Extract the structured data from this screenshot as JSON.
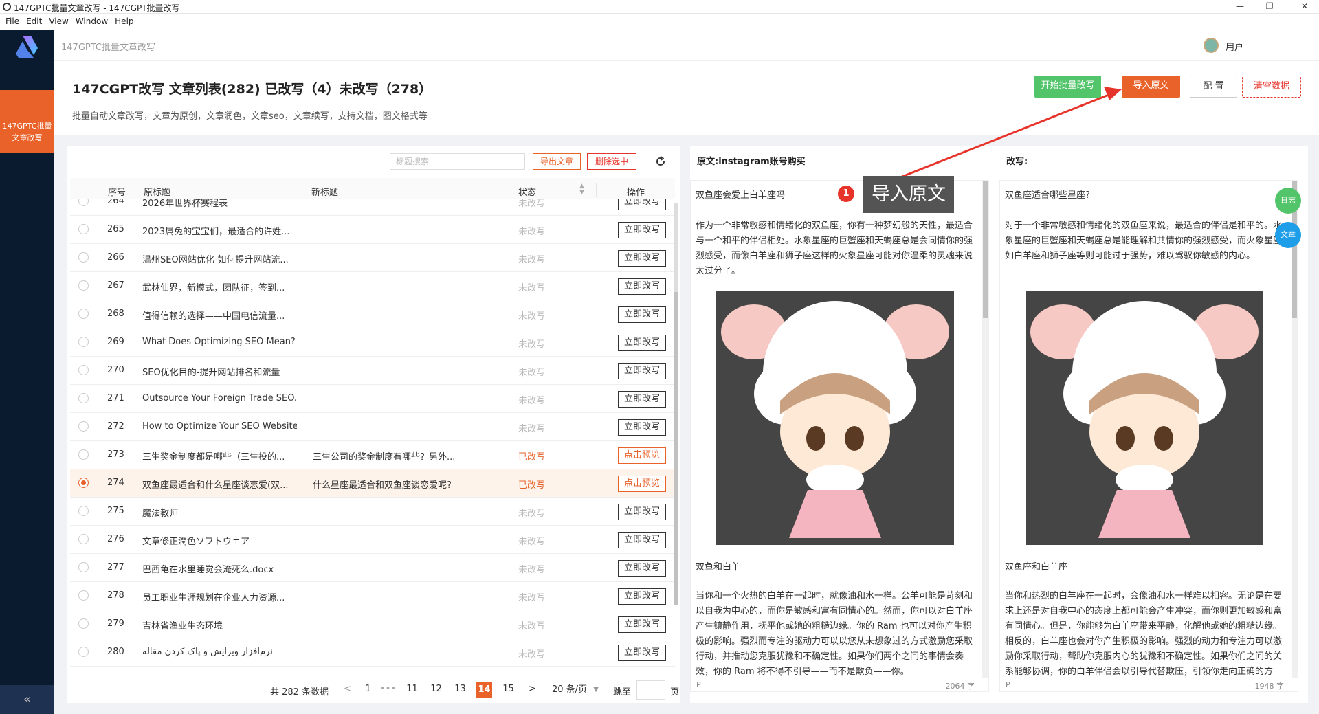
{
  "window": {
    "title": "147GPTC批量文章改写 - 147CGPT批量改写"
  },
  "menu": [
    "File",
    "Edit",
    "View",
    "Window",
    "Help"
  ],
  "sidebar": {
    "nav_line1": "147GPTC批量",
    "nav_line2": "文章改写",
    "collapse": "«"
  },
  "header": {
    "app_name": "147GPTC批量文章改写",
    "user": "用户"
  },
  "page": {
    "title": "147CGPT改写 文章列表(282) 已改写（4）未改写（278）",
    "description": "批量自动文章改写，文章为原创，文章润色，文章seo，文章续写，支持文档，图文格式等",
    "buttons": {
      "start": "开始批量改写",
      "import": "导入原文",
      "config": "配 置",
      "clear": "清空数据"
    }
  },
  "list": {
    "search_placeholder": "标题搜索",
    "export": "导出文章",
    "delete_selected": "删除选中",
    "columns": {
      "no": "序号",
      "orig": "原标题",
      "new": "新标题",
      "status": "状态",
      "action": "操作"
    },
    "rows": [
      {
        "no": "264",
        "orig": "2026年世界杯赛程表",
        "new": "",
        "status": "未改写",
        "action": "立即改写",
        "done": false,
        "selected": false
      },
      {
        "no": "265",
        "orig": "2023属兔的宝宝们，最适合的许姓...",
        "new": "",
        "status": "未改写",
        "action": "立即改写",
        "done": false,
        "selected": false
      },
      {
        "no": "266",
        "orig": "温州SEO网站优化-如何提升网站流...",
        "new": "",
        "status": "未改写",
        "action": "立即改写",
        "done": false,
        "selected": false
      },
      {
        "no": "267",
        "orig": "武林仙界，新模式，团队征，签到...",
        "new": "",
        "status": "未改写",
        "action": "立即改写",
        "done": false,
        "selected": false
      },
      {
        "no": "268",
        "orig": "值得信赖的选择——中国电信流量...",
        "new": "",
        "status": "未改写",
        "action": "立即改写",
        "done": false,
        "selected": false
      },
      {
        "no": "269",
        "orig": "What Does Optimizing SEO Mean?",
        "new": "",
        "status": "未改写",
        "action": "立即改写",
        "done": false,
        "selected": false
      },
      {
        "no": "270",
        "orig": "SEO优化目的-提升网站排名和流量",
        "new": "",
        "status": "未改写",
        "action": "立即改写",
        "done": false,
        "selected": false
      },
      {
        "no": "271",
        "orig": "Outsource Your Foreign Trade SEO...",
        "new": "",
        "status": "未改写",
        "action": "立即改写",
        "done": false,
        "selected": false
      },
      {
        "no": "272",
        "orig": "How to Optimize Your SEO Website",
        "new": "",
        "status": "未改写",
        "action": "立即改写",
        "done": false,
        "selected": false
      },
      {
        "no": "273",
        "orig": "三生奖金制度都是哪些（三生投的...",
        "new": "三生公司的奖金制度有哪些？另外...",
        "status": "已改写",
        "action": "点击预览",
        "done": true,
        "selected": false
      },
      {
        "no": "274",
        "orig": "双鱼座最适合和什么星座谈恋爱(双...",
        "new": "什么星座最适合和双鱼座谈恋爱呢?",
        "status": "已改写",
        "action": "点击预览",
        "done": true,
        "selected": true
      },
      {
        "no": "275",
        "orig": "魔法教师",
        "new": "",
        "status": "未改写",
        "action": "立即改写",
        "done": false,
        "selected": false
      },
      {
        "no": "276",
        "orig": "文章修正潤色ソフトウェア",
        "new": "",
        "status": "未改写",
        "action": "立即改写",
        "done": false,
        "selected": false
      },
      {
        "no": "277",
        "orig": "巴西龟在水里睡觉会淹死么.docx",
        "new": "",
        "status": "未改写",
        "action": "立即改写",
        "done": false,
        "selected": false
      },
      {
        "no": "278",
        "orig": "员工职业生涯规划在企业人力资源...",
        "new": "",
        "status": "未改写",
        "action": "立即改写",
        "done": false,
        "selected": false
      },
      {
        "no": "279",
        "orig": "吉林省渔业生态环境",
        "new": "",
        "status": "未改写",
        "action": "立即改写",
        "done": false,
        "selected": false
      },
      {
        "no": "280",
        "orig": "نرم‌افزار ویرایش و پاک کردن مقاله",
        "new": "",
        "status": "未改写",
        "action": "立即改写",
        "done": false,
        "selected": false
      }
    ],
    "pager": {
      "total": "共 282 条数据",
      "prev": "<",
      "next": ">",
      "ellipsis": "•••",
      "pages": [
        "1",
        "11",
        "12",
        "13",
        "14",
        "15"
      ],
      "current": "14",
      "page_size": "20 条/页",
      "jump": "跳至",
      "page_unit": "页"
    }
  },
  "original": {
    "header": "原文:instagram账号购买",
    "title": "双鱼座会爱上白羊座吗",
    "para1": "作为一个非常敏感和情绪化的双鱼座，你有一种梦幻般的天性，最适合与一个和平的伴侣相处。水象星座的巨蟹座和天蝎座总是会同情你的强烈感受，而像白羊座和狮子座这样的火象星座可能对你温柔的灵魂来说太过分了。",
    "subtitle": "双鱼和白羊",
    "para2": "当你和一个火热的白羊在一起时，就像油和水一样。公羊可能是苛刻和以自我为中心的，而你是敏感和富有同情心的。然而，你可以对白羊座产生镇静作用，抚平他或她的粗糙边缘。你的 Ram 也可以对你产生积极的影响。强烈而专注的驱动力可以以您从未想象过的方式激励您采取行动，并推动您克服犹豫和不确定性。如果你们两个之间的事情会奏效，你的 Ram 将不得不引导——而不是欺负——你。",
    "foot_p": "P",
    "count": "2064 字"
  },
  "rewrite": {
    "header": "改写:",
    "title": "双鱼座适合哪些星座?",
    "para1": "对于一个非常敏感和情绪化的双鱼座来说，最适合的伴侣是和平的。水象星座的巨蟹座和天蝎座总是能理解和共情你的强烈感受，而火象星座如白羊座和狮子座等则可能过于强势，难以驾驭你敏感的内心。",
    "subtitle": "双鱼座和白羊座",
    "para2": "当你和热烈的白羊座在一起时，会像油和水一样难以相容。无论是在要求上还是对自我中心的态度上都可能会产生冲突，而你则更加敏感和富有同情心。但是，你能够为白羊座带来平静，化解他或她的粗糙边缘。相反的，白羊座也会对你产生积极的影响。强烈的动力和专注力可以激励你采取行动，帮助你克服内心的犹豫和不确定性。如果你们之间的关系能够协调，你的白羊伴侣会以引导代替欺压，引领你走向正确的方向。",
    "foot_p": "P",
    "count": "1948 字"
  },
  "float": {
    "log": "日志",
    "article": "文章"
  },
  "callout": {
    "num": "1",
    "text": "导入原文"
  },
  "colors": {
    "accent": "#e8622a",
    "green": "#52c46a",
    "sidebar": "#0a1b30",
    "danger": "#e7342b"
  }
}
